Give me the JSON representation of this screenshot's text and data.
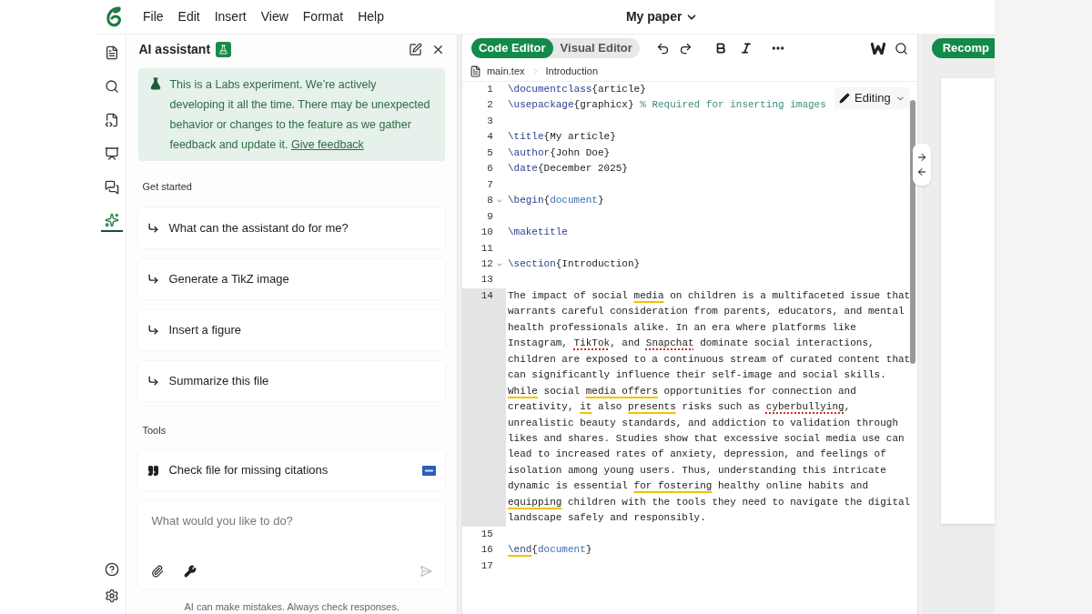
{
  "menu": [
    "File",
    "Edit",
    "Insert",
    "View",
    "Format",
    "Help"
  ],
  "project_title": "My paper",
  "rail": [
    {
      "selected": false
    },
    {
      "selected": false
    },
    {
      "selected": false
    },
    {
      "selected": false
    },
    {
      "selected": false
    },
    {
      "selected": true
    }
  ],
  "assistant": {
    "title": "AI assistant",
    "notice": "This is a Labs experiment. We’re actively developing it all the time. There may be unexpected behavior or changes to the feature as we gather feedback and update it.",
    "notice_link": "Give feedback",
    "sections": [
      {
        "heading": "Get started",
        "items": [
          {
            "label": "What can the assistant do for me?",
            "kind": "prompt"
          },
          {
            "label": "Generate a TikZ image",
            "kind": "prompt"
          },
          {
            "label": "Insert a figure",
            "kind": "prompt"
          },
          {
            "label": "Summarize this file",
            "kind": "prompt"
          }
        ]
      },
      {
        "heading": "Tools",
        "items": [
          {
            "label": "Check file for missing citations",
            "kind": "tool"
          }
        ]
      }
    ],
    "input": {
      "placeholder": "What would you like to do?"
    },
    "disclaimer": "AI can make mistakes. Always check responses."
  },
  "editor": {
    "modes": [
      {
        "label": "Code Editor",
        "selected": true
      },
      {
        "label": "Visual Editor",
        "selected": false
      }
    ],
    "recompile": "Recomp",
    "breadcrumb": [
      "main.tex",
      "Introduction"
    ],
    "editing": "Editing",
    "lines": [
      {
        "number": "1",
        "fold": false,
        "active": false,
        "segments": [
          {
            "kind": "cmd",
            "text": "\\documentclass"
          },
          {
            "kind": "text",
            "text": "{article}"
          }
        ]
      },
      {
        "number": "2",
        "fold": false,
        "active": false,
        "segments": [
          {
            "kind": "cmd",
            "text": "\\usepackage"
          },
          {
            "kind": "text",
            "text": "{graphicx} "
          },
          {
            "kind": "comment",
            "text": "% Required for inserting images"
          }
        ]
      },
      {
        "number": "3",
        "fold": false,
        "active": false
      },
      {
        "number": "4",
        "fold": false,
        "active": false,
        "segments": [
          {
            "kind": "cmd",
            "text": "\\title"
          },
          {
            "kind": "text",
            "text": "{My article}"
          }
        ]
      },
      {
        "number": "5",
        "fold": false,
        "active": false,
        "segments": [
          {
            "kind": "cmd",
            "text": "\\author"
          },
          {
            "kind": "text",
            "text": "{John Doe}"
          }
        ]
      },
      {
        "number": "6",
        "fold": false,
        "active": false,
        "segments": [
          {
            "kind": "cmd",
            "text": "\\date"
          },
          {
            "kind": "text",
            "text": "{December 2025}"
          }
        ]
      },
      {
        "number": "7",
        "fold": false,
        "active": false
      },
      {
        "number": "8",
        "fold": true,
        "active": false,
        "segments": [
          {
            "kind": "cmd",
            "text": "\\begin"
          },
          {
            "kind": "text",
            "text": "{"
          },
          {
            "kind": "env",
            "text": "document"
          },
          {
            "kind": "text",
            "text": "}"
          }
        ]
      },
      {
        "number": "9",
        "fold": false,
        "active": false
      },
      {
        "number": "10",
        "fold": false,
        "active": false,
        "segments": [
          {
            "kind": "cmd",
            "text": "\\maketitle"
          }
        ]
      },
      {
        "number": "11",
        "fold": false,
        "active": false
      },
      {
        "number": "12",
        "fold": true,
        "active": false,
        "segments": [
          {
            "kind": "cmd",
            "text": "\\section"
          },
          {
            "kind": "text",
            "text": "{Introduction}"
          }
        ]
      },
      {
        "number": "13",
        "fold": false,
        "active": false
      },
      {
        "number": "14",
        "fold": false,
        "active": true,
        "segments": [
          {
            "kind": "text",
            "text": "The impact of social "
          },
          {
            "kind": "grammar",
            "text": "media"
          },
          {
            "kind": "text",
            "text": " on children is a multifaceted issue that warrants careful consideration from parents, educators, and mental health professionals alike. In an era where platforms like Instagram, "
          },
          {
            "kind": "spelling",
            "text": "TikTok"
          },
          {
            "kind": "text",
            "text": ", and "
          },
          {
            "kind": "spelling",
            "text": "Snapchat"
          },
          {
            "kind": "text",
            "text": " dominate social interactions, children are exposed to a continuous stream of curated content that can significantly influence their self-image and social skills. "
          },
          {
            "kind": "grammar",
            "text": "While"
          },
          {
            "kind": "text",
            "text": " social "
          },
          {
            "kind": "grammar",
            "text": "media offers"
          },
          {
            "kind": "text",
            "text": " opportunities for connection and creativity, "
          },
          {
            "kind": "grammar",
            "text": "it"
          },
          {
            "kind": "text",
            "text": " also "
          },
          {
            "kind": "grammar",
            "text": "presents"
          },
          {
            "kind": "text",
            "text": " risks such as "
          },
          {
            "kind": "spelling",
            "text": "cyberbullying"
          },
          {
            "kind": "text",
            "text": ", unrealistic beauty standards, and addiction to validation through likes and shares. Studies show that excessive social media use can lead to increased rates of anxiety, depression, and feelings of isolation among young users. Thus, understanding this intricate dynamic is essential "
          },
          {
            "kind": "grammar",
            "text": "for fostering"
          },
          {
            "kind": "text",
            "text": " healthy online habits and "
          },
          {
            "kind": "grammar",
            "text": "equipping"
          },
          {
            "kind": "text",
            "text": " children with the tools they need to navigate the digital landscape safely and responsibly."
          }
        ]
      },
      {
        "number": "15",
        "fold": false,
        "active": false
      },
      {
        "number": "16",
        "fold": false,
        "active": false,
        "segments": [
          {
            "kind": "cmd-grammar",
            "text": "\\end"
          },
          {
            "kind": "text",
            "text": "{"
          },
          {
            "kind": "env",
            "text": "document"
          },
          {
            "kind": "text",
            "text": "}"
          }
        ]
      },
      {
        "number": "17",
        "fold": false,
        "active": false
      }
    ]
  }
}
